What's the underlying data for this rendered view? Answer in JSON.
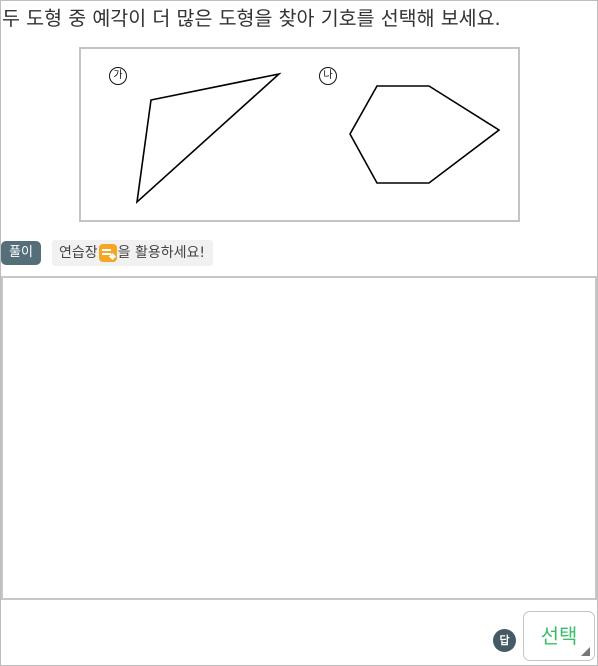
{
  "question": {
    "text": "두 도형 중 예각이 더 많은 도형을 찾아 기호를 선택해 보세요."
  },
  "figures": [
    {
      "label": "가"
    },
    {
      "label": "나"
    }
  ],
  "solution": {
    "badge": "풀이",
    "hint_before": "연습장",
    "hint_after": "을 활용하세요!",
    "hint_icon": "pencil-note-icon"
  },
  "answer": {
    "badge": "답",
    "select_label": "선택"
  },
  "colors": {
    "badge_bg": "#546e7a",
    "answer_badge_bg": "#455a64",
    "select_text": "#3bbd6b",
    "icon_accent": "#f5a623"
  }
}
